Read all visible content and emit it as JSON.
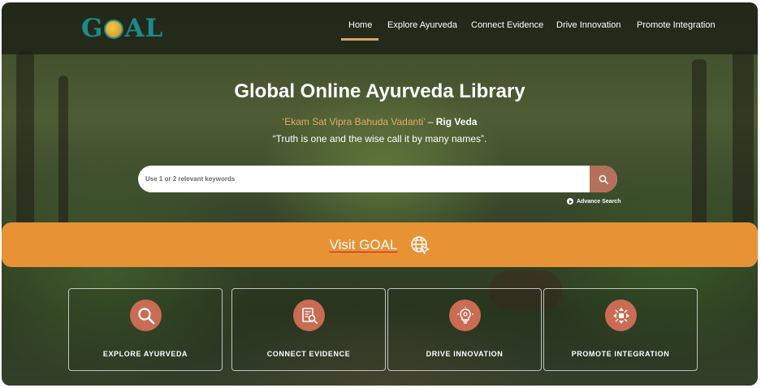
{
  "brand": {
    "logo_text_left": "G",
    "logo_text_right": "AL"
  },
  "nav": {
    "items": [
      {
        "label": "Home",
        "active": true
      },
      {
        "label": "Explore Ayurveda"
      },
      {
        "label": "Connect Evidence"
      },
      {
        "label": "Drive Innovation"
      },
      {
        "label": "Promote Integration"
      }
    ]
  },
  "hero": {
    "title": "Global Online Ayurveda Library",
    "quote_sanskrit": "‘Ekam Sat Vipra Bahuda Vadanti’",
    "quote_separator": " – ",
    "quote_source": "Rig Veda",
    "quote_english": "“Truth is one and the wise call it by many names”."
  },
  "search": {
    "placeholder": "Use 1 or 2 relevant keywords",
    "value": "",
    "button_icon": "search-icon",
    "advance_label": "Advance Search"
  },
  "visit": {
    "label": "Visit GOAL",
    "icon": "globe-cursor-icon"
  },
  "cards": [
    {
      "label": "EXPLORE AYURVEDA",
      "icon": "search-icon"
    },
    {
      "label": "CONNECT EVIDENCE",
      "icon": "document-search-icon"
    },
    {
      "label": "DRIVE INNOVATION",
      "icon": "lightbulb-icon"
    },
    {
      "label": "PROMOTE INTEGRATION",
      "icon": "integration-arrows-icon"
    }
  ],
  "colors": {
    "accent_orange": "#e89236",
    "icon_circle": "#c96c53",
    "search_button": "#b4705a",
    "logo_teal": "#1c8a8a",
    "quote_sanskrit": "#e6a86a"
  }
}
